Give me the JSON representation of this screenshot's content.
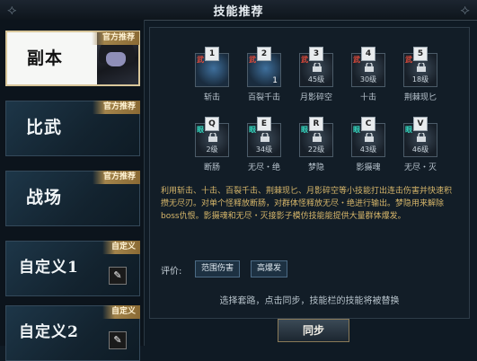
{
  "title": "技能推荐",
  "tabs": [
    {
      "label": "副本",
      "badge": "官方推荐"
    },
    {
      "label": "比武",
      "badge": "官方推荐"
    },
    {
      "label": "战场",
      "badge": "官方推荐"
    },
    {
      "label": "自定义1",
      "badge": "自定义"
    },
    {
      "label": "自定义2",
      "badge": "自定义"
    }
  ],
  "skills_row1": [
    {
      "key": "1",
      "type": "武",
      "name": "斩击",
      "level": "",
      "num": ""
    },
    {
      "key": "2",
      "type": "武",
      "name": "百裂千击",
      "level": "",
      "num": "1"
    },
    {
      "key": "3",
      "type": "武",
      "name": "月影碎空",
      "level": "45级",
      "num": ""
    },
    {
      "key": "4",
      "type": "武",
      "name": "十击",
      "level": "30级",
      "num": ""
    },
    {
      "key": "5",
      "type": "武",
      "name": "荆棘现匕",
      "level": "18级",
      "num": ""
    }
  ],
  "skills_row2": [
    {
      "key": "Q",
      "type": "眼",
      "name": "断肠",
      "level": "2级",
      "num": ""
    },
    {
      "key": "E",
      "type": "眼",
      "name": "无尽・绝",
      "level": "34级",
      "num": ""
    },
    {
      "key": "R",
      "type": "眼",
      "name": "梦隐",
      "level": "22级",
      "num": ""
    },
    {
      "key": "C",
      "type": "眼",
      "name": "影摄魂",
      "level": "43级",
      "num": ""
    },
    {
      "key": "V",
      "type": "眼",
      "name": "无尽・灭",
      "level": "46级",
      "num": ""
    }
  ],
  "description": "利用斩击、十击、百裂千击、荆棘现匕、月影碎空等小技能打出连击伤害并快速积攒无尽刃。对单个怪释放断肠，对群体怪释放无尽・绝进行输出。梦隐用来解除boss仇恨。影摄魂和无尽・灭接影子模仿技能能提供大量群体爆发。",
  "rating_label": "评价:",
  "rating_tags": [
    "范围伤害",
    "高爆发"
  ],
  "hint": "选择套路，点击同步，技能栏的技能将被替换",
  "sync_label": "同步",
  "colors": {
    "accent_gold": "#d6b66a",
    "attack_type": "#e34b3b",
    "eye_type": "#35d7c0"
  }
}
